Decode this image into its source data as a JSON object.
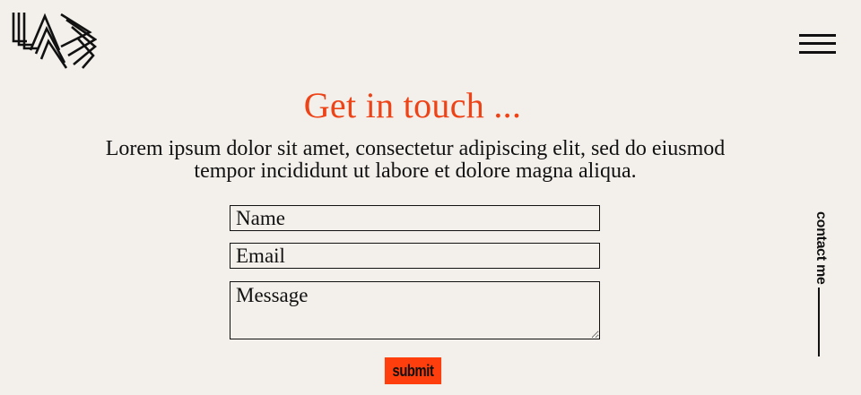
{
  "header": {
    "logo_icon": "wave-lines-logo",
    "menu_icon": "hamburger-menu-icon"
  },
  "main": {
    "title": "Get in touch ...",
    "intro": "Lorem ipsum dolor sit amet, consectetur adipiscing elit, sed do eiusmod tempor incididunt ut labore et dolore magna aliqua."
  },
  "form": {
    "name_placeholder": "Name",
    "email_placeholder": "Email",
    "message_placeholder": "Message",
    "submit_label": "submit"
  },
  "side": {
    "contact_label": "contact me"
  },
  "colors": {
    "background": "#f3f0eb",
    "accent": "#ee4217",
    "button": "#ff3e0d",
    "text": "#111111"
  }
}
